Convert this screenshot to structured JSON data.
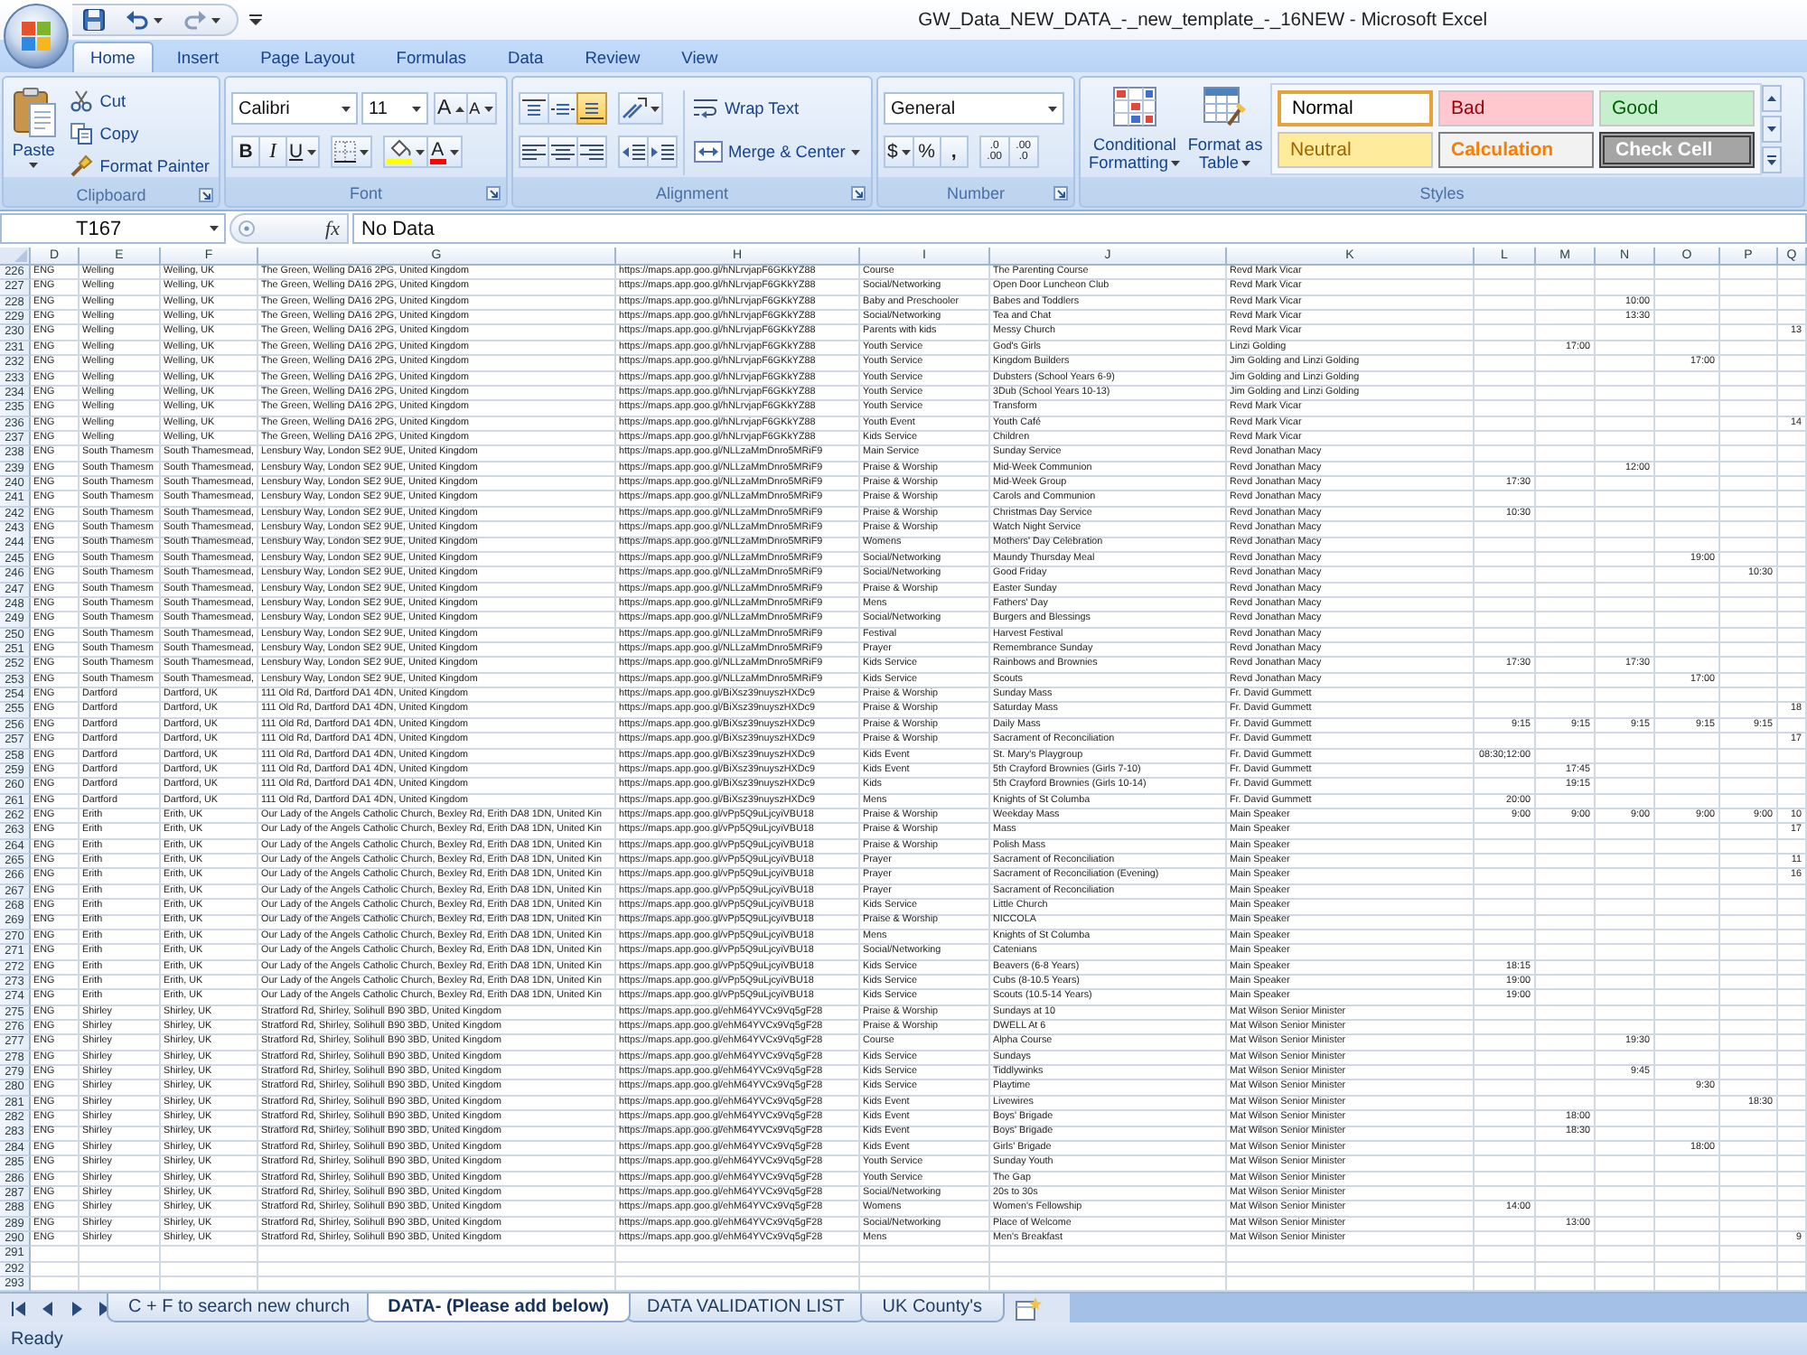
{
  "window": {
    "title": "GW_Data_NEW_DATA_-_new_template_-_16NEW - Microsoft Excel"
  },
  "ribbon_tabs": [
    {
      "label": "Home",
      "selected": true
    },
    {
      "label": "Insert",
      "selected": false
    },
    {
      "label": "Page Layout",
      "selected": false
    },
    {
      "label": "Formulas",
      "selected": false
    },
    {
      "label": "Data",
      "selected": false
    },
    {
      "label": "Review",
      "selected": false
    },
    {
      "label": "View",
      "selected": false
    }
  ],
  "clipboard": {
    "paste": "Paste",
    "cut": "Cut",
    "copy": "Copy",
    "format_painter": "Format Painter",
    "label": "Clipboard"
  },
  "font": {
    "family": "Calibri",
    "size": "11",
    "grow": "A",
    "shrink": "A",
    "bold": "B",
    "italic": "I",
    "underline": "U",
    "font_color": "A",
    "label": "Font"
  },
  "alignment": {
    "vertical": [
      {
        "kind": "top",
        "selected": false
      },
      {
        "kind": "middle",
        "selected": false
      },
      {
        "kind": "bottom",
        "selected": true
      }
    ],
    "horizontal": [
      {
        "kind": "left",
        "selected": false
      },
      {
        "kind": "center",
        "selected": false
      },
      {
        "kind": "right",
        "selected": false
      }
    ],
    "wrap_text": "Wrap Text",
    "merge": "Merge & Center",
    "label": "Alignment"
  },
  "number": {
    "format": "General",
    "currency": "$",
    "percent": "%",
    "comma": ",",
    "increase_decimal": ".0 .00",
    "decrease_decimal": ".00 .0",
    "label": "Number"
  },
  "styles": {
    "conditional_formatting": "Conditional Formatting",
    "format_as_table": "Format as Table",
    "cells": [
      {
        "label": "Normal",
        "kind": "normal",
        "selected": true
      },
      {
        "label": "Bad",
        "kind": "bad",
        "selected": false
      },
      {
        "label": "Good",
        "kind": "good",
        "selected": false
      },
      {
        "label": "Neutral",
        "kind": "neutral",
        "selected": false
      },
      {
        "label": "Calculation",
        "kind": "calculation",
        "selected": false
      },
      {
        "label": "Check Cell",
        "kind": "check",
        "selected": false
      }
    ],
    "label": "Styles"
  },
  "formula_bar": {
    "name_box": "T167",
    "function_label": "fx",
    "value": "No Data"
  },
  "columns": [
    "D",
    "E",
    "F",
    "G",
    "H",
    "I",
    "J",
    "K",
    "L",
    "M",
    "N",
    "O",
    "P",
    "Q"
  ],
  "rows": [
    {
      "number": "226",
      "cells": [
        "ENG",
        "Welling",
        "Welling, UK",
        "The Green, Welling DA16 2PG, United Kingdom",
        "https://maps.app.goo.gl/hNLrvjapF6GKkYZ88",
        "Course",
        "The Parenting Course",
        "Revd Mark Vicar"
      ]
    },
    {
      "number": "227",
      "cells": [
        "ENG",
        "Welling",
        "Welling, UK",
        "The Green, Welling DA16 2PG, United Kingdom",
        "https://maps.app.goo.gl/hNLrvjapF6GKkYZ88",
        "Social/Networking",
        "Open Door Luncheon Club",
        "Revd Mark Vicar"
      ]
    },
    {
      "number": "228",
      "cells": [
        "ENG",
        "Welling",
        "Welling, UK",
        "The Green, Welling DA16 2PG, United Kingdom",
        "https://maps.app.goo.gl/hNLrvjapF6GKkYZ88",
        "Baby and Preschooler",
        "Babes and Toddlers",
        "Revd Mark Vicar",
        null,
        null,
        "10:00"
      ]
    },
    {
      "number": "229",
      "cells": [
        "ENG",
        "Welling",
        "Welling, UK",
        "The Green, Welling DA16 2PG, United Kingdom",
        "https://maps.app.goo.gl/hNLrvjapF6GKkYZ88",
        "Social/Networking",
        "Tea and Chat",
        "Revd Mark Vicar",
        null,
        null,
        "13:30"
      ]
    },
    {
      "number": "230",
      "cells": [
        "ENG",
        "Welling",
        "Welling, UK",
        "The Green, Welling DA16 2PG, United Kingdom",
        "https://maps.app.goo.gl/hNLrvjapF6GKkYZ88",
        "Parents with kids",
        "Messy Church",
        "Revd Mark Vicar",
        null,
        null,
        null,
        null,
        null,
        "13"
      ]
    },
    {
      "number": "231",
      "cells": [
        "ENG",
        "Welling",
        "Welling, UK",
        "The Green, Welling DA16 2PG, United Kingdom",
        "https://maps.app.goo.gl/hNLrvjapF6GKkYZ88",
        "Youth Service",
        "God's Girls",
        "Linzi Golding",
        null,
        "17:00"
      ]
    },
    {
      "number": "232",
      "cells": [
        "ENG",
        "Welling",
        "Welling, UK",
        "The Green, Welling DA16 2PG, United Kingdom",
        "https://maps.app.goo.gl/hNLrvjapF6GKkYZ88",
        "Youth Service",
        "Kingdom Builders",
        "Jim Golding and Linzi Golding",
        null,
        null,
        null,
        "17:00"
      ]
    },
    {
      "number": "233",
      "cells": [
        "ENG",
        "Welling",
        "Welling, UK",
        "The Green, Welling DA16 2PG, United Kingdom",
        "https://maps.app.goo.gl/hNLrvjapF6GKkYZ88",
        "Youth Service",
        "Dubsters (School Years 6-9)",
        "Jim Golding and Linzi Golding"
      ]
    },
    {
      "number": "234",
      "cells": [
        "ENG",
        "Welling",
        "Welling, UK",
        "The Green, Welling DA16 2PG, United Kingdom",
        "https://maps.app.goo.gl/hNLrvjapF6GKkYZ88",
        "Youth Service",
        "3Dub (School Years 10-13)",
        "Jim Golding and Linzi Golding"
      ]
    },
    {
      "number": "235",
      "cells": [
        "ENG",
        "Welling",
        "Welling, UK",
        "The Green, Welling DA16 2PG, United Kingdom",
        "https://maps.app.goo.gl/hNLrvjapF6GKkYZ88",
        "Youth Service",
        "Transform",
        "Revd Mark Vicar"
      ]
    },
    {
      "number": "236",
      "cells": [
        "ENG",
        "Welling",
        "Welling, UK",
        "The Green, Welling DA16 2PG, United Kingdom",
        "https://maps.app.goo.gl/hNLrvjapF6GKkYZ88",
        "Youth Event",
        "Youth Café",
        "Revd Mark Vicar",
        null,
        null,
        null,
        null,
        null,
        "14"
      ]
    },
    {
      "number": "237",
      "cells": [
        "ENG",
        "Welling",
        "Welling, UK",
        "The Green, Welling DA16 2PG, United Kingdom",
        "https://maps.app.goo.gl/hNLrvjapF6GKkYZ88",
        "Kids Service",
        "Children",
        "Revd Mark Vicar"
      ]
    },
    {
      "number": "238",
      "cells": [
        "ENG",
        "South Thamesm",
        "South Thamesmead,",
        "Lensbury Way, London SE2 9UE, United Kingdom",
        "https://maps.app.goo.gl/NLLzaMmDnro5MRiF9",
        "Main Service",
        "Sunday Service",
        "Revd Jonathan Macy"
      ]
    },
    {
      "number": "239",
      "cells": [
        "ENG",
        "South Thamesm",
        "South Thamesmead,",
        "Lensbury Way, London SE2 9UE, United Kingdom",
        "https://maps.app.goo.gl/NLLzaMmDnro5MRiF9",
        "Praise & Worship",
        "Mid-Week Communion",
        "Revd Jonathan Macy",
        null,
        null,
        "12:00"
      ]
    },
    {
      "number": "240",
      "cells": [
        "ENG",
        "South Thamesm",
        "South Thamesmead,",
        "Lensbury Way, London SE2 9UE, United Kingdom",
        "https://maps.app.goo.gl/NLLzaMmDnro5MRiF9",
        "Praise & Worship",
        "Mid-Week Group",
        "Revd Jonathan Macy",
        "17:30"
      ]
    },
    {
      "number": "241",
      "cells": [
        "ENG",
        "South Thamesm",
        "South Thamesmead,",
        "Lensbury Way, London SE2 9UE, United Kingdom",
        "https://maps.app.goo.gl/NLLzaMmDnro5MRiF9",
        "Praise & Worship",
        "Carols and Communion",
        "Revd Jonathan Macy"
      ]
    },
    {
      "number": "242",
      "cells": [
        "ENG",
        "South Thamesm",
        "South Thamesmead,",
        "Lensbury Way, London SE2 9UE, United Kingdom",
        "https://maps.app.goo.gl/NLLzaMmDnro5MRiF9",
        "Praise & Worship",
        "Christmas Day Service",
        "Revd Jonathan Macy",
        "10:30"
      ]
    },
    {
      "number": "243",
      "cells": [
        "ENG",
        "South Thamesm",
        "South Thamesmead,",
        "Lensbury Way, London SE2 9UE, United Kingdom",
        "https://maps.app.goo.gl/NLLzaMmDnro5MRiF9",
        "Praise & Worship",
        "Watch Night Service",
        "Revd Jonathan Macy"
      ]
    },
    {
      "number": "244",
      "cells": [
        "ENG",
        "South Thamesm",
        "South Thamesmead,",
        "Lensbury Way, London SE2 9UE, United Kingdom",
        "https://maps.app.goo.gl/NLLzaMmDnro5MRiF9",
        "Womens",
        "Mothers' Day Celebration",
        "Revd Jonathan Macy"
      ]
    },
    {
      "number": "245",
      "cells": [
        "ENG",
        "South Thamesm",
        "South Thamesmead,",
        "Lensbury Way, London SE2 9UE, United Kingdom",
        "https://maps.app.goo.gl/NLLzaMmDnro5MRiF9",
        "Social/Networking",
        "Maundy Thursday Meal",
        "Revd Jonathan Macy",
        null,
        null,
        null,
        "19:00"
      ]
    },
    {
      "number": "246",
      "cells": [
        "ENG",
        "South Thamesm",
        "South Thamesmead,",
        "Lensbury Way, London SE2 9UE, United Kingdom",
        "https://maps.app.goo.gl/NLLzaMmDnro5MRiF9",
        "Social/Networking",
        "Good Friday",
        "Revd Jonathan Macy",
        null,
        null,
        null,
        null,
        "10:30"
      ]
    },
    {
      "number": "247",
      "cells": [
        "ENG",
        "South Thamesm",
        "South Thamesmead,",
        "Lensbury Way, London SE2 9UE, United Kingdom",
        "https://maps.app.goo.gl/NLLzaMmDnro5MRiF9",
        "Praise & Worship",
        "Easter Sunday",
        "Revd Jonathan Macy"
      ]
    },
    {
      "number": "248",
      "cells": [
        "ENG",
        "South Thamesm",
        "South Thamesmead,",
        "Lensbury Way, London SE2 9UE, United Kingdom",
        "https://maps.app.goo.gl/NLLzaMmDnro5MRiF9",
        "Mens",
        "Fathers' Day",
        "Revd Jonathan Macy"
      ]
    },
    {
      "number": "249",
      "cells": [
        "ENG",
        "South Thamesm",
        "South Thamesmead,",
        "Lensbury Way, London SE2 9UE, United Kingdom",
        "https://maps.app.goo.gl/NLLzaMmDnro5MRiF9",
        "Social/Networking",
        "Burgers and Blessings",
        "Revd Jonathan Macy"
      ]
    },
    {
      "number": "250",
      "cells": [
        "ENG",
        "South Thamesm",
        "South Thamesmead,",
        "Lensbury Way, London SE2 9UE, United Kingdom",
        "https://maps.app.goo.gl/NLLzaMmDnro5MRiF9",
        "Festival",
        "Harvest Festival",
        "Revd Jonathan Macy"
      ]
    },
    {
      "number": "251",
      "cells": [
        "ENG",
        "South Thamesm",
        "South Thamesmead,",
        "Lensbury Way, London SE2 9UE, United Kingdom",
        "https://maps.app.goo.gl/NLLzaMmDnro5MRiF9",
        "Prayer",
        "Remembrance Sunday",
        "Revd Jonathan Macy"
      ]
    },
    {
      "number": "252",
      "cells": [
        "ENG",
        "South Thamesm",
        "South Thamesmead,",
        "Lensbury Way, London SE2 9UE, United Kingdom",
        "https://maps.app.goo.gl/NLLzaMmDnro5MRiF9",
        "Kids Service",
        "Rainbows and Brownies",
        "Revd Jonathan Macy",
        "17:30",
        null,
        "17:30"
      ]
    },
    {
      "number": "253",
      "cells": [
        "ENG",
        "South Thamesm",
        "South Thamesmead,",
        "Lensbury Way, London SE2 9UE, United Kingdom",
        "https://maps.app.goo.gl/NLLzaMmDnro5MRiF9",
        "Kids Service",
        "Scouts",
        "Revd Jonathan Macy",
        null,
        null,
        null,
        "17:00"
      ]
    },
    {
      "number": "254",
      "cells": [
        "ENG",
        "Dartford",
        "Dartford, UK",
        "111 Old Rd, Dartford DA1 4DN, United Kingdom",
        "https://maps.app.goo.gl/BiXsz39nuyszHXDc9",
        "Praise & Worship",
        "Sunday Mass",
        "Fr. David Gummett"
      ]
    },
    {
      "number": "255",
      "cells": [
        "ENG",
        "Dartford",
        "Dartford, UK",
        "111 Old Rd, Dartford DA1 4DN, United Kingdom",
        "https://maps.app.goo.gl/BiXsz39nuyszHXDc9",
        "Praise & Worship",
        "Saturday Mass",
        "Fr. David Gummett",
        null,
        null,
        null,
        null,
        null,
        "18"
      ]
    },
    {
      "number": "256",
      "cells": [
        "ENG",
        "Dartford",
        "Dartford, UK",
        "111 Old Rd, Dartford DA1 4DN, United Kingdom",
        "https://maps.app.goo.gl/BiXsz39nuyszHXDc9",
        "Praise & Worship",
        "Daily Mass",
        "Fr. David Gummett",
        "9:15",
        "9:15",
        "9:15",
        "9:15",
        "9:15"
      ]
    },
    {
      "number": "257",
      "cells": [
        "ENG",
        "Dartford",
        "Dartford, UK",
        "111 Old Rd, Dartford DA1 4DN, United Kingdom",
        "https://maps.app.goo.gl/BiXsz39nuyszHXDc9",
        "Praise & Worship",
        "Sacrament of Reconciliation",
        "Fr. David Gummett",
        null,
        null,
        null,
        null,
        null,
        "17"
      ]
    },
    {
      "number": "258",
      "cells": [
        "ENG",
        "Dartford",
        "Dartford, UK",
        "111 Old Rd, Dartford DA1 4DN, United Kingdom",
        "https://maps.app.goo.gl/BiXsz39nuyszHXDc9",
        "Kids Event",
        "St. Mary's Playgroup",
        "Fr. David Gummett",
        "08:30;12:00"
      ]
    },
    {
      "number": "259",
      "cells": [
        "ENG",
        "Dartford",
        "Dartford, UK",
        "111 Old Rd, Dartford DA1 4DN, United Kingdom",
        "https://maps.app.goo.gl/BiXsz39nuyszHXDc9",
        "Kids Event",
        "5th Crayford Brownies (Girls 7-10)",
        "Fr. David Gummett",
        null,
        "17:45"
      ]
    },
    {
      "number": "260",
      "cells": [
        "ENG",
        "Dartford",
        "Dartford, UK",
        "111 Old Rd, Dartford DA1 4DN, United Kingdom",
        "https://maps.app.goo.gl/BiXsz39nuyszHXDc9",
        "Kids",
        "5th Crayford Brownies (Girls 10-14)",
        "Fr. David Gummett",
        null,
        "19:15"
      ]
    },
    {
      "number": "261",
      "cells": [
        "ENG",
        "Dartford",
        "Dartford, UK",
        "111 Old Rd, Dartford DA1 4DN, United Kingdom",
        "https://maps.app.goo.gl/BiXsz39nuyszHXDc9",
        "Mens",
        "Knights of St Columba",
        "Fr. David Gummett",
        "20:00"
      ]
    },
    {
      "number": "262",
      "cells": [
        "ENG",
        "Erith",
        "Erith, UK",
        "Our Lady of the Angels Catholic Church, Bexley Rd, Erith DA8 1DN, United Kin",
        "https://maps.app.goo.gl/vPp5Q9uLjcyiVBU18",
        "Praise & Worship",
        "Weekday Mass",
        "Main Speaker",
        "9:00",
        "9:00",
        "9:00",
        "9:00",
        "9:00",
        "10"
      ]
    },
    {
      "number": "263",
      "cells": [
        "ENG",
        "Erith",
        "Erith, UK",
        "Our Lady of the Angels Catholic Church, Bexley Rd, Erith DA8 1DN, United Kin",
        "https://maps.app.goo.gl/vPp5Q9uLjcyiVBU18",
        "Praise & Worship",
        "Mass",
        "Main Speaker",
        null,
        null,
        null,
        null,
        null,
        "17"
      ]
    },
    {
      "number": "264",
      "cells": [
        "ENG",
        "Erith",
        "Erith, UK",
        "Our Lady of the Angels Catholic Church, Bexley Rd, Erith DA8 1DN, United Kin",
        "https://maps.app.goo.gl/vPp5Q9uLjcyiVBU18",
        "Praise & Worship",
        "Polish Mass",
        "Main Speaker"
      ]
    },
    {
      "number": "265",
      "cells": [
        "ENG",
        "Erith",
        "Erith, UK",
        "Our Lady of the Angels Catholic Church, Bexley Rd, Erith DA8 1DN, United Kin",
        "https://maps.app.goo.gl/vPp5Q9uLjcyiVBU18",
        "Prayer",
        "Sacrament of Reconciliation",
        "Main Speaker",
        null,
        null,
        null,
        null,
        null,
        "11"
      ]
    },
    {
      "number": "266",
      "cells": [
        "ENG",
        "Erith",
        "Erith, UK",
        "Our Lady of the Angels Catholic Church, Bexley Rd, Erith DA8 1DN, United Kin",
        "https://maps.app.goo.gl/vPp5Q9uLjcyiVBU18",
        "Prayer",
        "Sacrament of Reconciliation (Evening)",
        "Main Speaker",
        null,
        null,
        null,
        null,
        null,
        "16"
      ]
    },
    {
      "number": "267",
      "cells": [
        "ENG",
        "Erith",
        "Erith, UK",
        "Our Lady of the Angels Catholic Church, Bexley Rd, Erith DA8 1DN, United Kin",
        "https://maps.app.goo.gl/vPp5Q9uLjcyiVBU18",
        "Prayer",
        "Sacrament of Reconciliation",
        "Main Speaker"
      ]
    },
    {
      "number": "268",
      "cells": [
        "ENG",
        "Erith",
        "Erith, UK",
        "Our Lady of the Angels Catholic Church, Bexley Rd, Erith DA8 1DN, United Kin",
        "https://maps.app.goo.gl/vPp5Q9uLjcyiVBU18",
        "Kids Service",
        "Little Church",
        "Main Speaker"
      ]
    },
    {
      "number": "269",
      "cells": [
        "ENG",
        "Erith",
        "Erith, UK",
        "Our Lady of the Angels Catholic Church, Bexley Rd, Erith DA8 1DN, United Kin",
        "https://maps.app.goo.gl/vPp5Q9uLjcyiVBU18",
        "Praise & Worship",
        "NICCOLA",
        "Main Speaker"
      ]
    },
    {
      "number": "270",
      "cells": [
        "ENG",
        "Erith",
        "Erith, UK",
        "Our Lady of the Angels Catholic Church, Bexley Rd, Erith DA8 1DN, United Kin",
        "https://maps.app.goo.gl/vPp5Q9uLjcyiVBU18",
        "Mens",
        "Knights of St Columba",
        "Main Speaker"
      ]
    },
    {
      "number": "271",
      "cells": [
        "ENG",
        "Erith",
        "Erith, UK",
        "Our Lady of the Angels Catholic Church, Bexley Rd, Erith DA8 1DN, United Kin",
        "https://maps.app.goo.gl/vPp5Q9uLjcyiVBU18",
        "Social/Networking",
        "Catenians",
        "Main Speaker"
      ]
    },
    {
      "number": "272",
      "cells": [
        "ENG",
        "Erith",
        "Erith, UK",
        "Our Lady of the Angels Catholic Church, Bexley Rd, Erith DA8 1DN, United Kin",
        "https://maps.app.goo.gl/vPp5Q9uLjcyiVBU18",
        "Kids Service",
        "Beavers (6-8 Years)",
        "Main Speaker",
        "18:15"
      ]
    },
    {
      "number": "273",
      "cells": [
        "ENG",
        "Erith",
        "Erith, UK",
        "Our Lady of the Angels Catholic Church, Bexley Rd, Erith DA8 1DN, United Kin",
        "https://maps.app.goo.gl/vPp5Q9uLjcyiVBU18",
        "Kids Service",
        "Cubs (8-10.5 Years)",
        "Main Speaker",
        "19:00"
      ]
    },
    {
      "number": "274",
      "cells": [
        "ENG",
        "Erith",
        "Erith, UK",
        "Our Lady of the Angels Catholic Church, Bexley Rd, Erith DA8 1DN, United Kin",
        "https://maps.app.goo.gl/vPp5Q9uLjcyiVBU18",
        "Kids Service",
        "Scouts (10.5-14 Years)",
        "Main Speaker",
        "19:00"
      ]
    },
    {
      "number": "275",
      "cells": [
        "ENG",
        "Shirley",
        "Shirley, UK",
        "Stratford Rd, Shirley, Solihull B90 3BD, United Kingdom",
        "https://maps.app.goo.gl/ehM64YVCx9Vq5gF28",
        "Praise & Worship",
        "Sundays at 10",
        "Mat Wilson Senior Minister"
      ]
    },
    {
      "number": "276",
      "cells": [
        "ENG",
        "Shirley",
        "Shirley, UK",
        "Stratford Rd, Shirley, Solihull B90 3BD, United Kingdom",
        "https://maps.app.goo.gl/ehM64YVCx9Vq5gF28",
        "Praise & Worship",
        "DWELL At 6",
        "Mat Wilson Senior Minister"
      ]
    },
    {
      "number": "277",
      "cells": [
        "ENG",
        "Shirley",
        "Shirley, UK",
        "Stratford Rd, Shirley, Solihull B90 3BD, United Kingdom",
        "https://maps.app.goo.gl/ehM64YVCx9Vq5gF28",
        "Course",
        "Alpha Course",
        "Mat Wilson Senior Minister",
        null,
        null,
        "19:30"
      ]
    },
    {
      "number": "278",
      "cells": [
        "ENG",
        "Shirley",
        "Shirley, UK",
        "Stratford Rd, Shirley, Solihull B90 3BD, United Kingdom",
        "https://maps.app.goo.gl/ehM64YVCx9Vq5gF28",
        "Kids Service",
        "Sundays",
        "Mat Wilson Senior Minister"
      ]
    },
    {
      "number": "279",
      "cells": [
        "ENG",
        "Shirley",
        "Shirley, UK",
        "Stratford Rd, Shirley, Solihull B90 3BD, United Kingdom",
        "https://maps.app.goo.gl/ehM64YVCx9Vq5gF28",
        "Kids Service",
        "Tiddlywinks",
        "Mat Wilson Senior Minister",
        null,
        null,
        "9:45"
      ]
    },
    {
      "number": "280",
      "cells": [
        "ENG",
        "Shirley",
        "Shirley, UK",
        "Stratford Rd, Shirley, Solihull B90 3BD, United Kingdom",
        "https://maps.app.goo.gl/ehM64YVCx9Vq5gF28",
        "Kids Service",
        "Playtime",
        "Mat Wilson Senior Minister",
        null,
        null,
        null,
        "9:30"
      ]
    },
    {
      "number": "281",
      "cells": [
        "ENG",
        "Shirley",
        "Shirley, UK",
        "Stratford Rd, Shirley, Solihull B90 3BD, United Kingdom",
        "https://maps.app.goo.gl/ehM64YVCx9Vq5gF28",
        "Kids Event",
        "Livewires",
        "Mat Wilson Senior Minister",
        null,
        null,
        null,
        null,
        "18:30"
      ]
    },
    {
      "number": "282",
      "cells": [
        "ENG",
        "Shirley",
        "Shirley, UK",
        "Stratford Rd, Shirley, Solihull B90 3BD, United Kingdom",
        "https://maps.app.goo.gl/ehM64YVCx9Vq5gF28",
        "Kids Event",
        "Boys' Brigade",
        "Mat Wilson Senior Minister",
        null,
        "18:00"
      ]
    },
    {
      "number": "283",
      "cells": [
        "ENG",
        "Shirley",
        "Shirley, UK",
        "Stratford Rd, Shirley, Solihull B90 3BD, United Kingdom",
        "https://maps.app.goo.gl/ehM64YVCx9Vq5gF28",
        "Kids Event",
        "Boys' Brigade",
        "Mat Wilson Senior Minister",
        null,
        "18:30"
      ]
    },
    {
      "number": "284",
      "cells": [
        "ENG",
        "Shirley",
        "Shirley, UK",
        "Stratford Rd, Shirley, Solihull B90 3BD, United Kingdom",
        "https://maps.app.goo.gl/ehM64YVCx9Vq5gF28",
        "Kids Event",
        "Girls' Brigade",
        "Mat Wilson Senior Minister",
        null,
        null,
        null,
        "18:00"
      ]
    },
    {
      "number": "285",
      "cells": [
        "ENG",
        "Shirley",
        "Shirley, UK",
        "Stratford Rd, Shirley, Solihull B90 3BD, United Kingdom",
        "https://maps.app.goo.gl/ehM64YVCx9Vq5gF28",
        "Youth Service",
        "Sunday Youth",
        "Mat Wilson Senior Minister"
      ]
    },
    {
      "number": "286",
      "cells": [
        "ENG",
        "Shirley",
        "Shirley, UK",
        "Stratford Rd, Shirley, Solihull B90 3BD, United Kingdom",
        "https://maps.app.goo.gl/ehM64YVCx9Vq5gF28",
        "Youth Service",
        "The Gap",
        "Mat Wilson Senior Minister"
      ]
    },
    {
      "number": "287",
      "cells": [
        "ENG",
        "Shirley",
        "Shirley, UK",
        "Stratford Rd, Shirley, Solihull B90 3BD, United Kingdom",
        "https://maps.app.goo.gl/ehM64YVCx9Vq5gF28",
        "Social/Networking",
        "20s to 30s",
        "Mat Wilson Senior Minister"
      ]
    },
    {
      "number": "288",
      "cells": [
        "ENG",
        "Shirley",
        "Shirley, UK",
        "Stratford Rd, Shirley, Solihull B90 3BD, United Kingdom",
        "https://maps.app.goo.gl/ehM64YVCx9Vq5gF28",
        "Womens",
        "Women's Fellowship",
        "Mat Wilson Senior Minister",
        "14:00"
      ]
    },
    {
      "number": "289",
      "cells": [
        "ENG",
        "Shirley",
        "Shirley, UK",
        "Stratford Rd, Shirley, Solihull B90 3BD, United Kingdom",
        "https://maps.app.goo.gl/ehM64YVCx9Vq5gF28",
        "Social/Networking",
        "Place of Welcome",
        "Mat Wilson Senior Minister",
        null,
        "13:00"
      ]
    },
    {
      "number": "290",
      "cells": [
        "ENG",
        "Shirley",
        "Shirley, UK",
        "Stratford Rd, Shirley, Solihull B90 3BD, United Kingdom",
        "https://maps.app.goo.gl/ehM64YVCx9Vq5gF28",
        "Mens",
        "Men's Breakfast",
        "Mat Wilson Senior Minister",
        null,
        null,
        null,
        null,
        null,
        "9"
      ]
    },
    {
      "number": "291"
    },
    {
      "number": "292"
    },
    {
      "number": "293"
    }
  ],
  "sheet_tabs": [
    {
      "label": "C + F to search new church",
      "selected": false
    },
    {
      "label": "DATA- (Please add below)",
      "selected": true
    },
    {
      "label": "DATA VALIDATION LIST",
      "selected": false
    },
    {
      "label": "UK County's",
      "selected": false
    }
  ],
  "status_bar": {
    "text": "Ready"
  }
}
